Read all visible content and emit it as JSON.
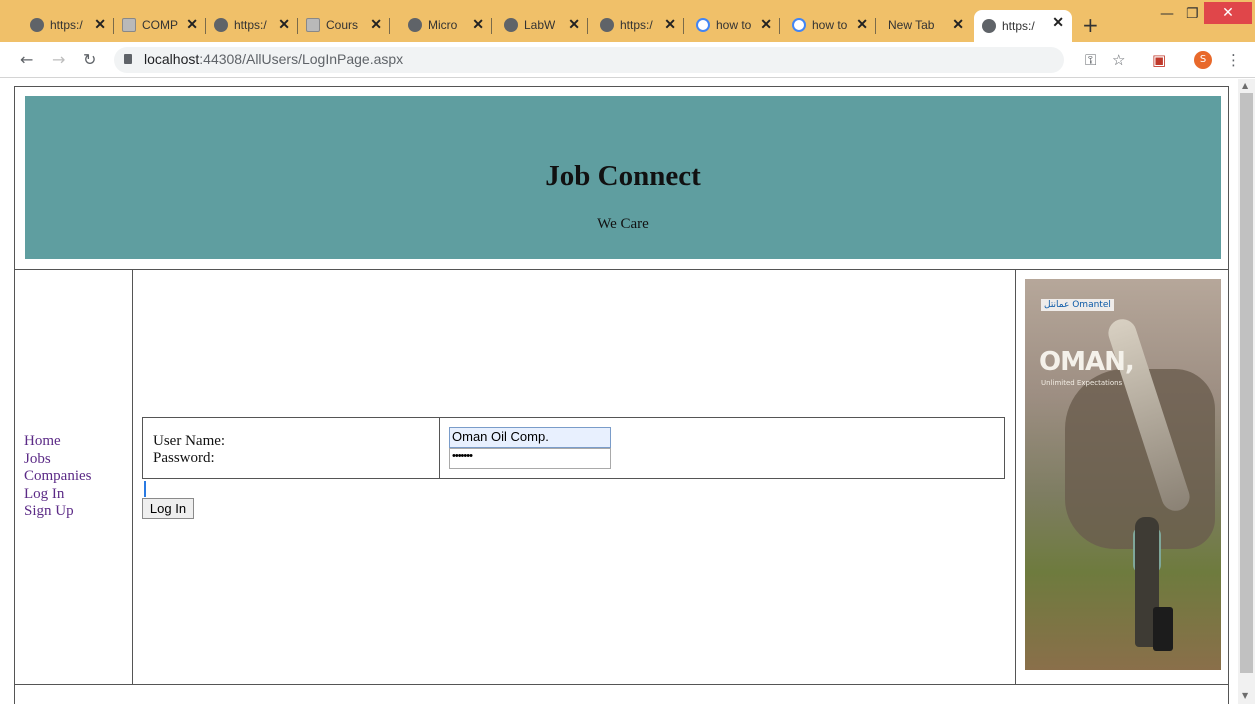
{
  "browser": {
    "tabs": [
      {
        "label": "https:/",
        "icon": "globe-icon"
      },
      {
        "label": "COMP",
        "icon": "document-icon"
      },
      {
        "label": "https:/",
        "icon": "globe-icon"
      },
      {
        "label": "Cours",
        "icon": "document-icon"
      },
      {
        "label": "Micro",
        "icon": "globe-icon"
      },
      {
        "label": "LabW",
        "icon": "globe-icon"
      },
      {
        "label": "https:/",
        "icon": "globe-icon"
      },
      {
        "label": "how to",
        "icon": "google-icon"
      },
      {
        "label": "how to",
        "icon": "google-icon"
      },
      {
        "label": "New Tab",
        "icon": ""
      },
      {
        "label": "https:/",
        "icon": "globe-icon",
        "active": true
      }
    ],
    "url_host": "localhost",
    "url_path": ":44308/AllUsers/LogInPage.aspx",
    "profile_initial": "S",
    "tab_strip_color": "#f0c069"
  },
  "page": {
    "site_title": "Job Connect",
    "tagline": "We Care",
    "header_color": "#5f9ea0",
    "nav": [
      "Home",
      "Jobs",
      "Companies",
      "Log In",
      "Sign Up"
    ],
    "login": {
      "username_label": "User Name:",
      "password_label": "Password:",
      "username_value": "Oman Oil Comp.",
      "password_value": "•••••••",
      "button_label": "Log In"
    },
    "ad": {
      "brand": "عمانتل Omantel",
      "headline": "OMAN,",
      "subline": "Unlimited Expectations"
    }
  }
}
